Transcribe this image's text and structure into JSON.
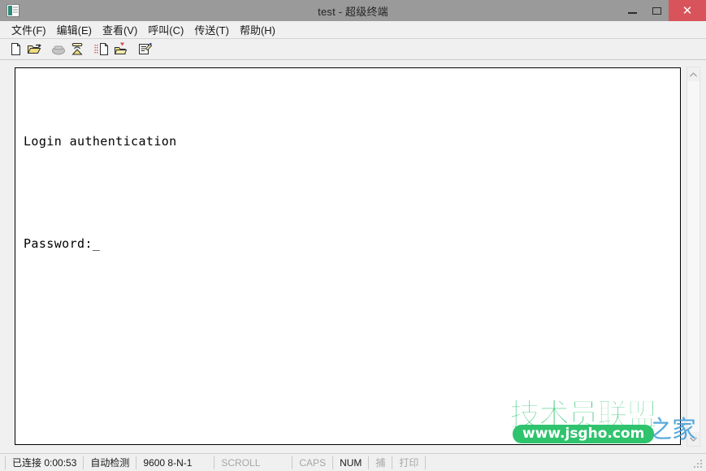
{
  "window": {
    "title": "test - 超级终端",
    "icon": "hyperterminal-icon",
    "caption": {
      "minimize": "–",
      "maximize": "□",
      "close": "✕"
    }
  },
  "menubar": {
    "items": [
      {
        "label": "文件(F)",
        "name": "menu-file"
      },
      {
        "label": "编辑(E)",
        "name": "menu-edit"
      },
      {
        "label": "查看(V)",
        "name": "menu-view"
      },
      {
        "label": "呼叫(C)",
        "name": "menu-call"
      },
      {
        "label": "传送(T)",
        "name": "menu-transfer"
      },
      {
        "label": "帮助(H)",
        "name": "menu-help"
      }
    ]
  },
  "toolbar": {
    "buttons": [
      {
        "name": "new-connection-icon",
        "enabled": true
      },
      {
        "name": "open-folder-icon",
        "enabled": true
      },
      {
        "name": "call-phone-icon",
        "enabled": false
      },
      {
        "name": "disconnect-phone-icon",
        "enabled": true
      },
      {
        "name": "send-file-icon",
        "enabled": true
      },
      {
        "name": "receive-file-icon",
        "enabled": true
      },
      {
        "name": "properties-icon",
        "enabled": true
      }
    ]
  },
  "terminal": {
    "lines": [
      "Login authentication",
      "",
      "Password:_"
    ],
    "cursor": "_",
    "background": "#ffffff",
    "foreground": "#000000"
  },
  "scrollbar": {
    "up_arrow": "︿",
    "down_arrow": "﹀"
  },
  "statusbar": {
    "cells": [
      {
        "label": "已连接 0:00:53",
        "name": "status-connected",
        "dim": false
      },
      {
        "label": "自动检测",
        "name": "status-autodetect",
        "dim": false
      },
      {
        "label": "9600 8-N-1",
        "name": "status-serial-settings",
        "dim": false
      },
      {
        "label": "SCROLL",
        "name": "status-scroll",
        "dim": true
      },
      {
        "label": "CAPS",
        "name": "status-caps",
        "dim": true
      },
      {
        "label": "NUM",
        "name": "status-num",
        "dim": false
      },
      {
        "label": "捕",
        "name": "status-capture",
        "dim": true
      },
      {
        "label": "打印",
        "name": "status-print",
        "dim": true
      }
    ]
  },
  "watermark": {
    "main": "技术员联盟",
    "url": "www.jsgho.com",
    "back": "之家",
    "color_main": "#2fc36e",
    "color_back": "#3a9bd8"
  }
}
